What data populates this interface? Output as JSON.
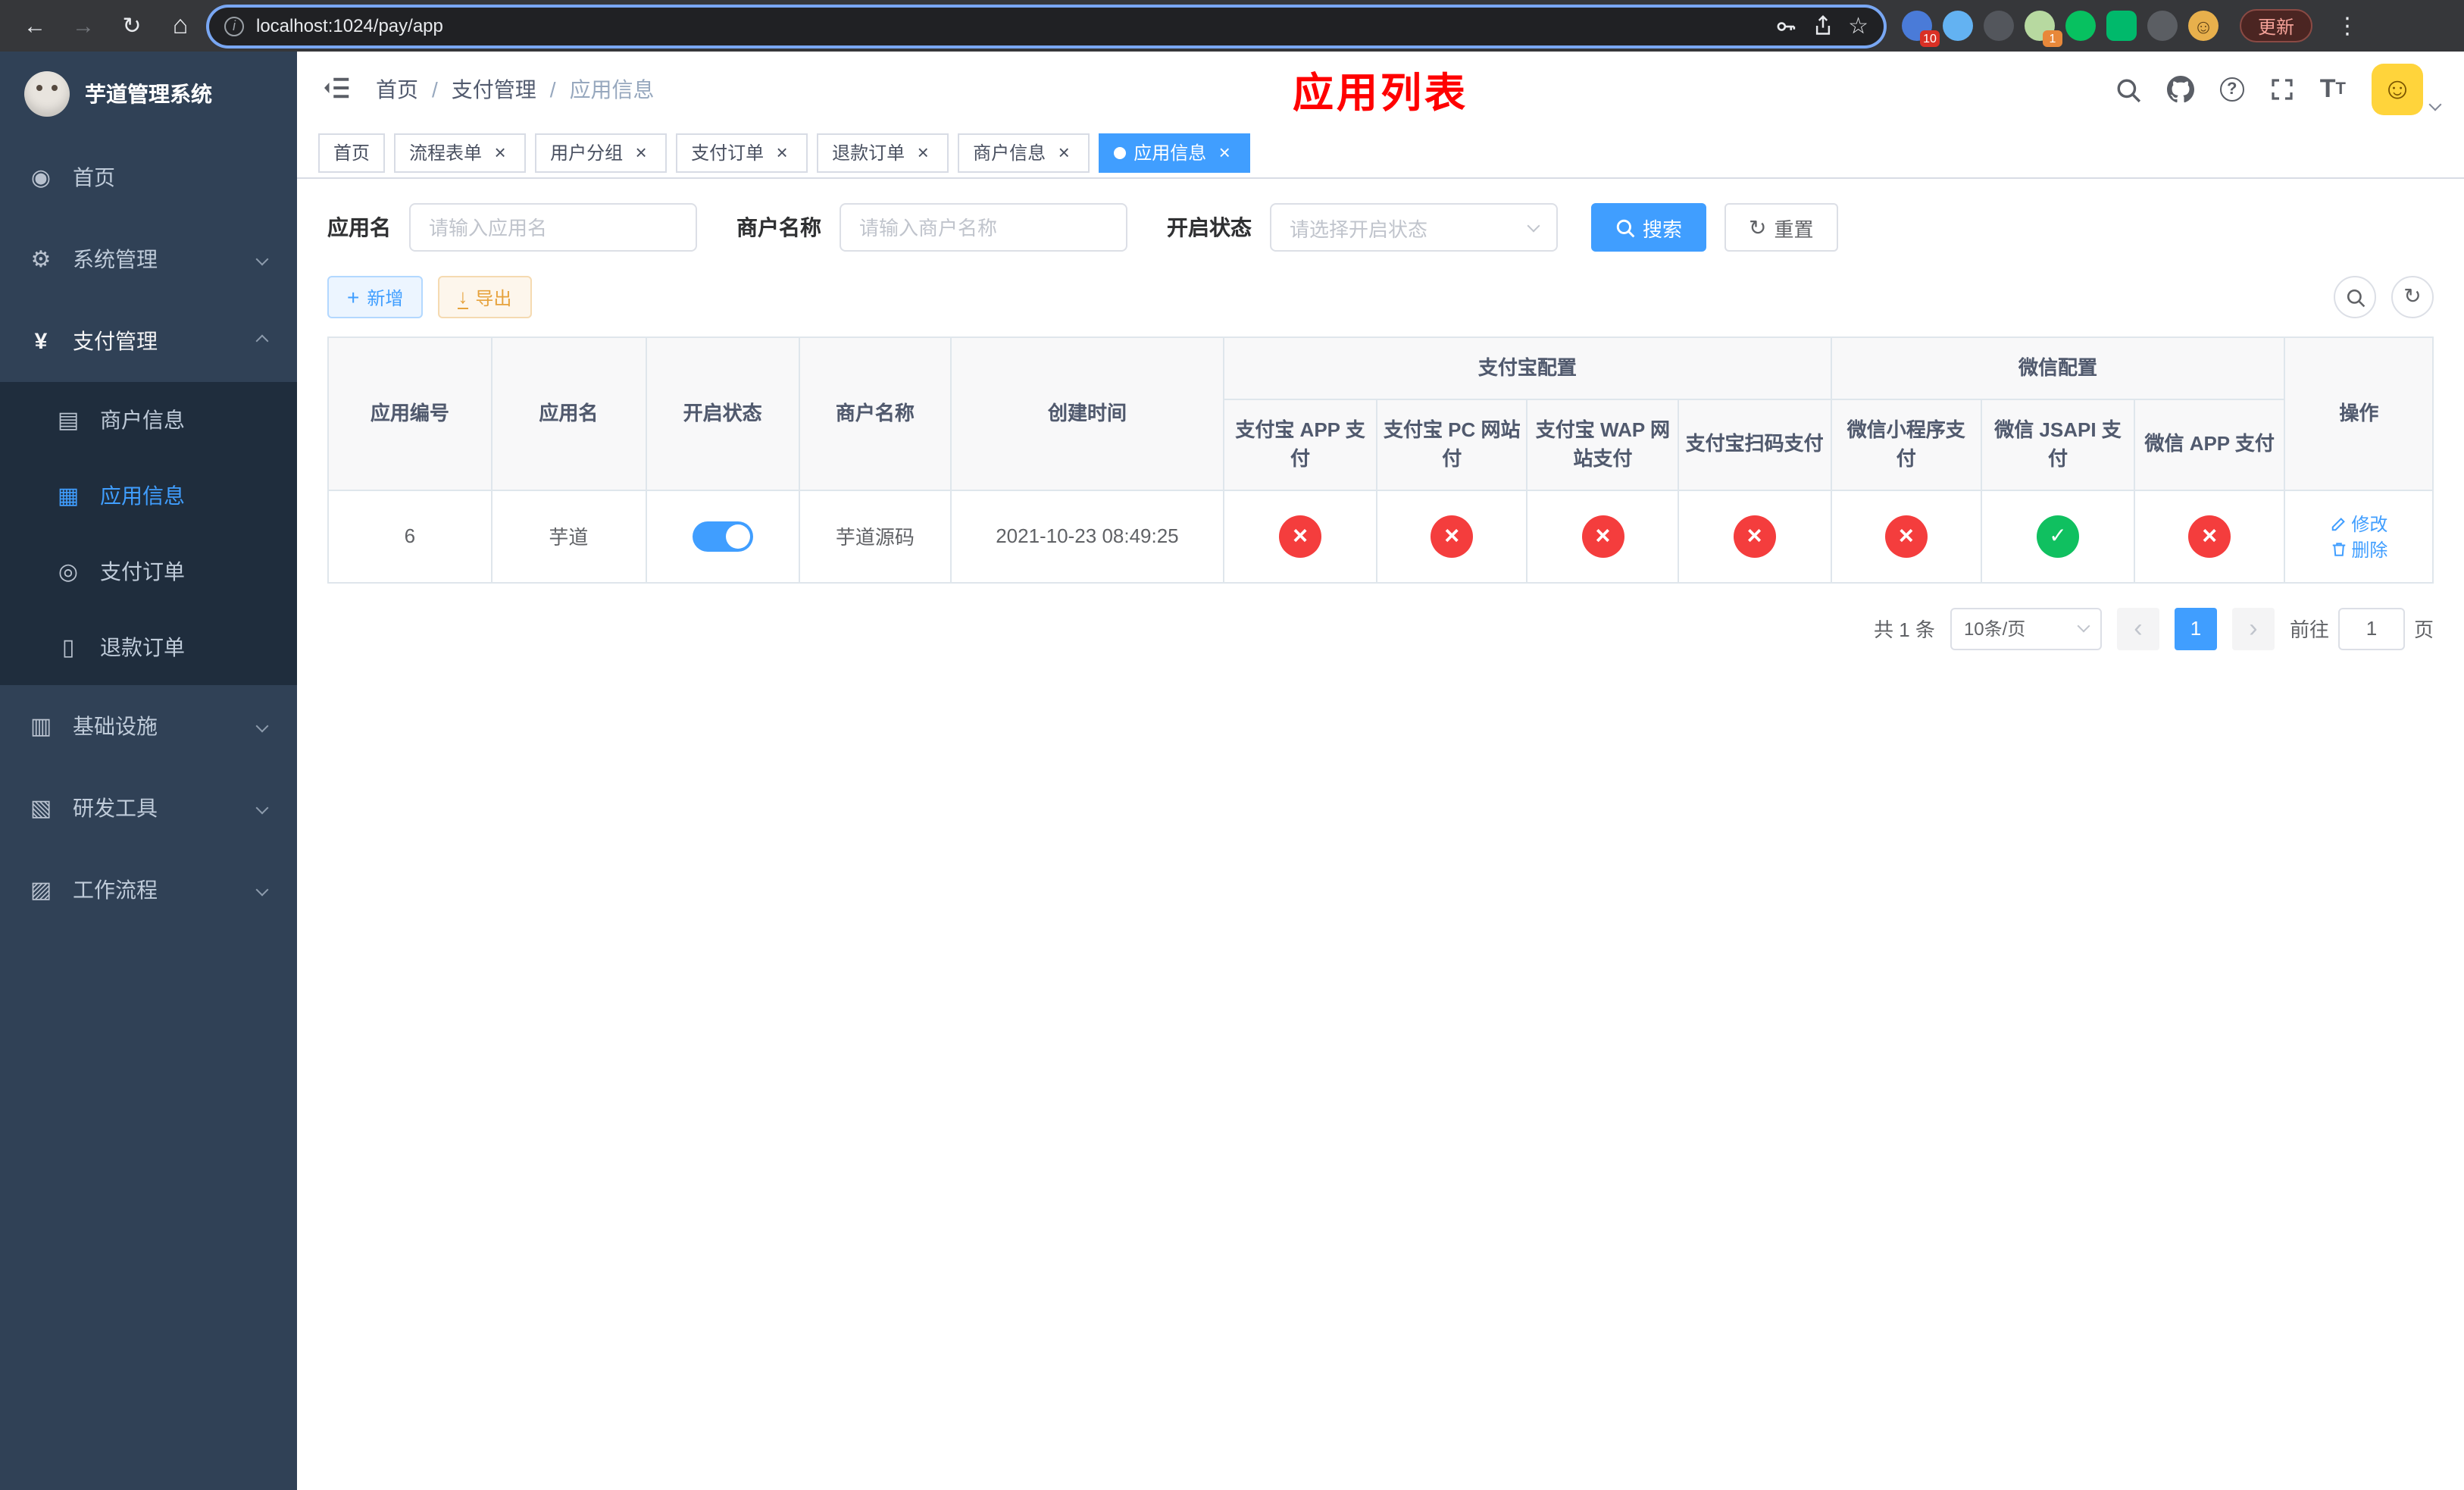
{
  "browser": {
    "url": "localhost:1024/pay/app",
    "update_label": "更新",
    "ext_badge_blue": "10",
    "ext_badge_green": "1"
  },
  "sidebar": {
    "logo_title": "芋道管理系统",
    "menu": [
      {
        "label": "首页"
      },
      {
        "label": "系统管理"
      },
      {
        "label": "支付管理"
      },
      {
        "label": "基础设施"
      },
      {
        "label": "研发工具"
      },
      {
        "label": "工作流程"
      }
    ],
    "pay_submenu": [
      {
        "label": "商户信息"
      },
      {
        "label": "应用信息"
      },
      {
        "label": "支付订单"
      },
      {
        "label": "退款订单"
      }
    ]
  },
  "header": {
    "breadcrumb": [
      "首页",
      "支付管理",
      "应用信息"
    ],
    "overlay_title": "应用列表"
  },
  "tabs": [
    {
      "label": "首页"
    },
    {
      "label": "流程表单"
    },
    {
      "label": "用户分组"
    },
    {
      "label": "支付订单"
    },
    {
      "label": "退款订单"
    },
    {
      "label": "商户信息"
    },
    {
      "label": "应用信息"
    }
  ],
  "search": {
    "app_name_label": "应用名",
    "app_name_placeholder": "请输入应用名",
    "merchant_label": "商户名称",
    "merchant_placeholder": "请输入商户名称",
    "status_label": "开启状态",
    "status_placeholder": "请选择开启状态",
    "search_button": "搜索",
    "reset_button": "重置"
  },
  "toolbar": {
    "add_button": "新增",
    "export_button": "导出"
  },
  "table": {
    "columns": {
      "app_id": "应用编号",
      "app_name": "应用名",
      "status": "开启状态",
      "merchant": "商户名称",
      "create_time": "创建时间",
      "alipay_group": "支付宝配置",
      "wechat_group": "微信配置",
      "alipay_app": "支付宝 APP 支付",
      "alipay_pc": "支付宝 PC 网站付",
      "alipay_wap": "支付宝 WAP 网站支付",
      "alipay_qr": "支付宝扫码支付",
      "wx_mini": "微信小程序支付",
      "wx_jsapi": "微信 JSAPI 支付",
      "wx_app": "微信 APP 支付",
      "action": "操作"
    },
    "row": {
      "app_id": "6",
      "app_name": "芋道",
      "enabled": true,
      "merchant": "芋道源码",
      "create_time": "2021-10-23 08:49:25",
      "configs": {
        "alipay_app": false,
        "alipay_pc": false,
        "alipay_wap": false,
        "alipay_qr": false,
        "wx_mini": false,
        "wx_jsapi": true,
        "wx_app": false
      },
      "edit_label": "修改",
      "delete_label": "删除"
    }
  },
  "pagination": {
    "total_text": "共 1 条",
    "page_size_text": "10条/页",
    "current_page": "1",
    "goto_prefix": "前往",
    "goto_suffix": "页",
    "goto_value": "1"
  }
}
